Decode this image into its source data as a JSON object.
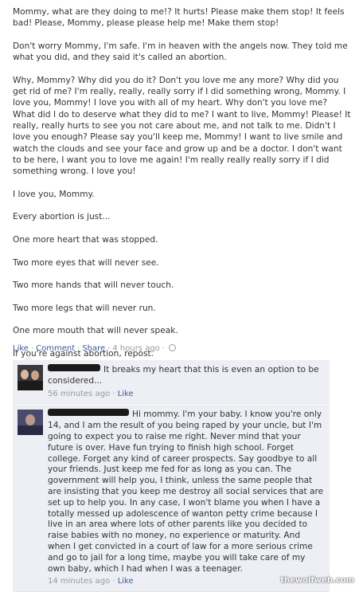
{
  "post": {
    "paragraphs": [
      "Mommy, what are they doing to me!? It hurts! Please make them stop! It feels bad! Please, Mommy, please please help me! Make them stop!",
      "Don't worry Mommy, I'm safe. I'm in heaven with the angels now. They told me what you did, and they said it's called an abortion.",
      "Why, Mommy? Why did you do it? Don't you love me any more? Why did you get rid of me? I'm really, really, really sorry if I did something wrong, Mommy. I love you, Mommy! I love you with all of my heart. Why don't you love me? What did I do to deserve what they did to me? I want to live, Mommy! Please! It really, really hurts to see you not care about me, and not talk to me. Didn't I love you enough? Please say you'll keep me, Mommy! I want to live smile and watch the clouds and see your face and grow up and be a doctor. I don't want to be here, I want you to love me again! I'm really really really sorry if I did something wrong. I love you!",
      "I love you, Mommy.",
      "Every abortion is just...",
      "One more heart that was stopped.",
      "Two more eyes that will never see.",
      "Two more hands that will never touch.",
      "Two more legs that will never run.",
      "One more mouth that will never speak.",
      "If you're against abortion, repost."
    ],
    "actions": {
      "like": "Like",
      "comment": "Comment",
      "share": "Share",
      "time": "4 hours ago"
    }
  },
  "comments": [
    {
      "text": "It breaks my heart that this is even an option to be considered...",
      "time": "56 minutes ago",
      "like": "Like"
    },
    {
      "text": "Hi mommy. I'm your baby. I know you're only 14, and I am the result of you being raped by your uncle, but I'm going to expect you to raise me right. Never mind that your future is over. Have fun trying to finish high school. Forget college. Forget any kind of career prospects. Say goodbye to all your friends. Just keep me fed for as long as you can. The government will help you, I think, unless the same people that are insisting that you keep me destroy all social services that are set up to help you. In any case, I won't blame you when I have a totally messed up adolescence of wanton petty crime because I live in an area where lots of other parents like you decided to raise babies with no money, no experience or maturity. And when I get convicted in a court of law for a more serious crime and go to jail for a long time, maybe you will take care of my own baby, which I had when I was a teenager.",
      "time": "14 minutes ago",
      "like": "Like"
    }
  ],
  "watermark": "thewolfweb.com",
  "colors": {
    "link": "#3b5998",
    "comment_bg": "#edeff4",
    "meta": "#999999"
  }
}
